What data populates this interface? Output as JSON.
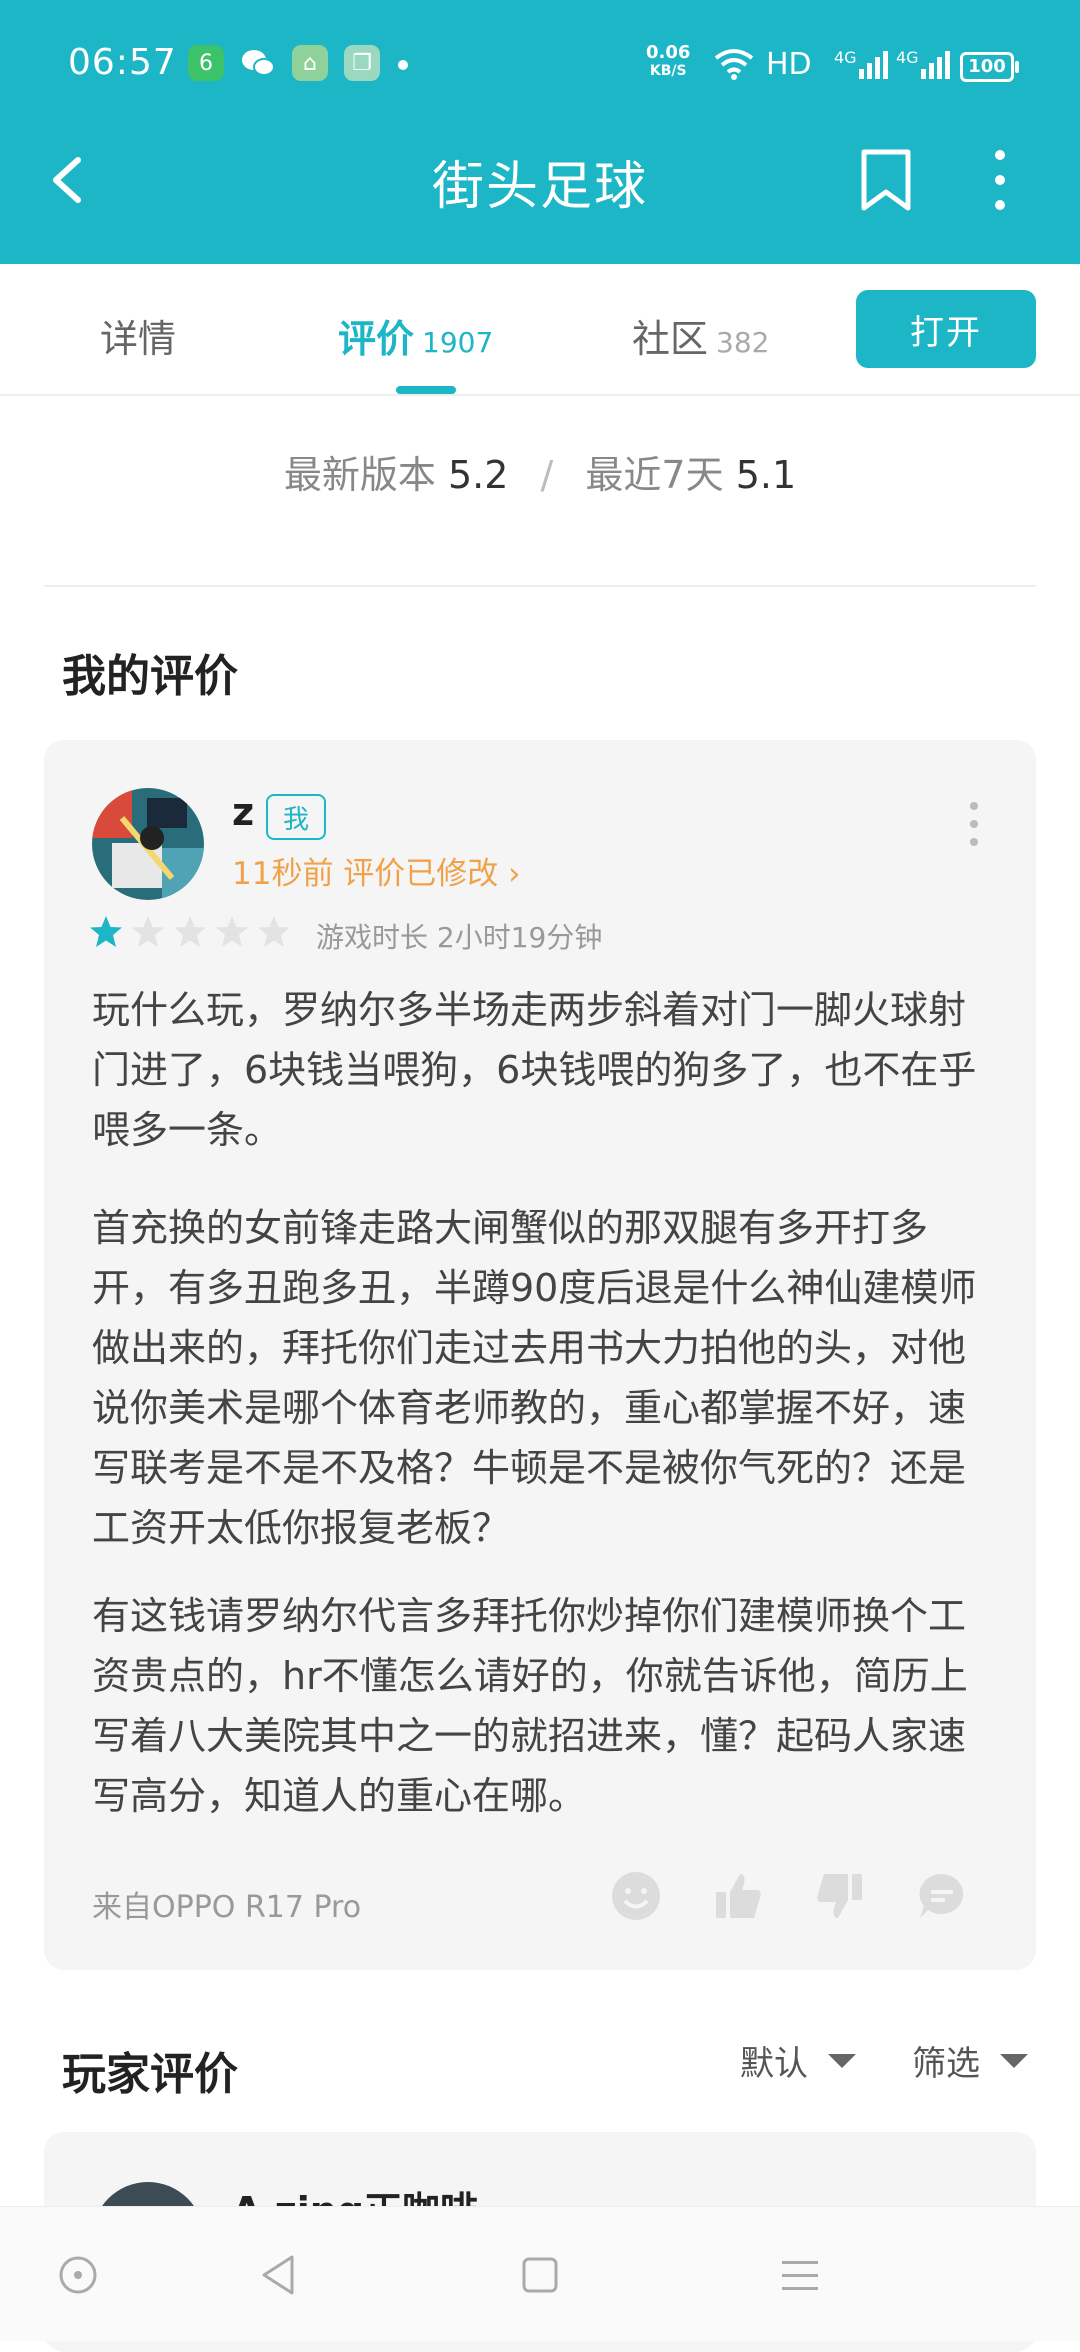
{
  "status_bar": {
    "time": "06:57",
    "net_speed_value": "0.06",
    "net_speed_unit": "KB/S",
    "network": "HD",
    "signal1": "4G",
    "signal2": "4G",
    "battery": "100"
  },
  "header": {
    "title": "街头足球",
    "accent_color": "#1db6c6"
  },
  "tabs": [
    {
      "label": "详情",
      "count": ""
    },
    {
      "label": "评价",
      "count": "1907"
    },
    {
      "label": "社区",
      "count": "382"
    }
  ],
  "open_button": "打开",
  "versions": {
    "latest_label": "最新版本",
    "latest_score": "5.2",
    "separator": "/",
    "recent_label": "最近7天",
    "recent_score": "5.1"
  },
  "my_review": {
    "section_title": "我的评价",
    "username": "z",
    "me_tag": "我",
    "edited": "11秒前 评价已修改 ›",
    "rating": 1,
    "rating_max": 5,
    "playtime": "游戏时长 2小时19分钟",
    "paragraphs": [
      "玩什么玩，罗纳尔多半场走两步斜着对门一脚火球射门进了，6块钱当喂狗，6块钱喂的狗多了，也不在乎喂多一条。",
      "首充换的女前锋走路大闸蟹似的那双腿有多开打多开，有多丑跑多丑，半蹲90度后退是什么神仙建模师做出来的，拜托你们走过去用书大力拍他的头，对他说你美术是哪个体育老师教的，重心都掌握不好，速写联考是不是不及格？牛顿是不是被你气死的？还是工资开太低你报复老板？",
      "有这钱请罗纳尔代言多拜托你炒掉你们建模师换个工资贵点的，hr不懂怎么请好的，你就告诉他，简历上写着八大美院其中之一的就招进来，懂？起码人家速写高分，知道人的重心在哪。"
    ],
    "device": "来自OPPO R17 Pro"
  },
  "player_reviews": {
    "section_title": "玩家评价",
    "sort_label": "默认",
    "filter_label": "筛选",
    "first_username": "A zing正咖啡"
  }
}
